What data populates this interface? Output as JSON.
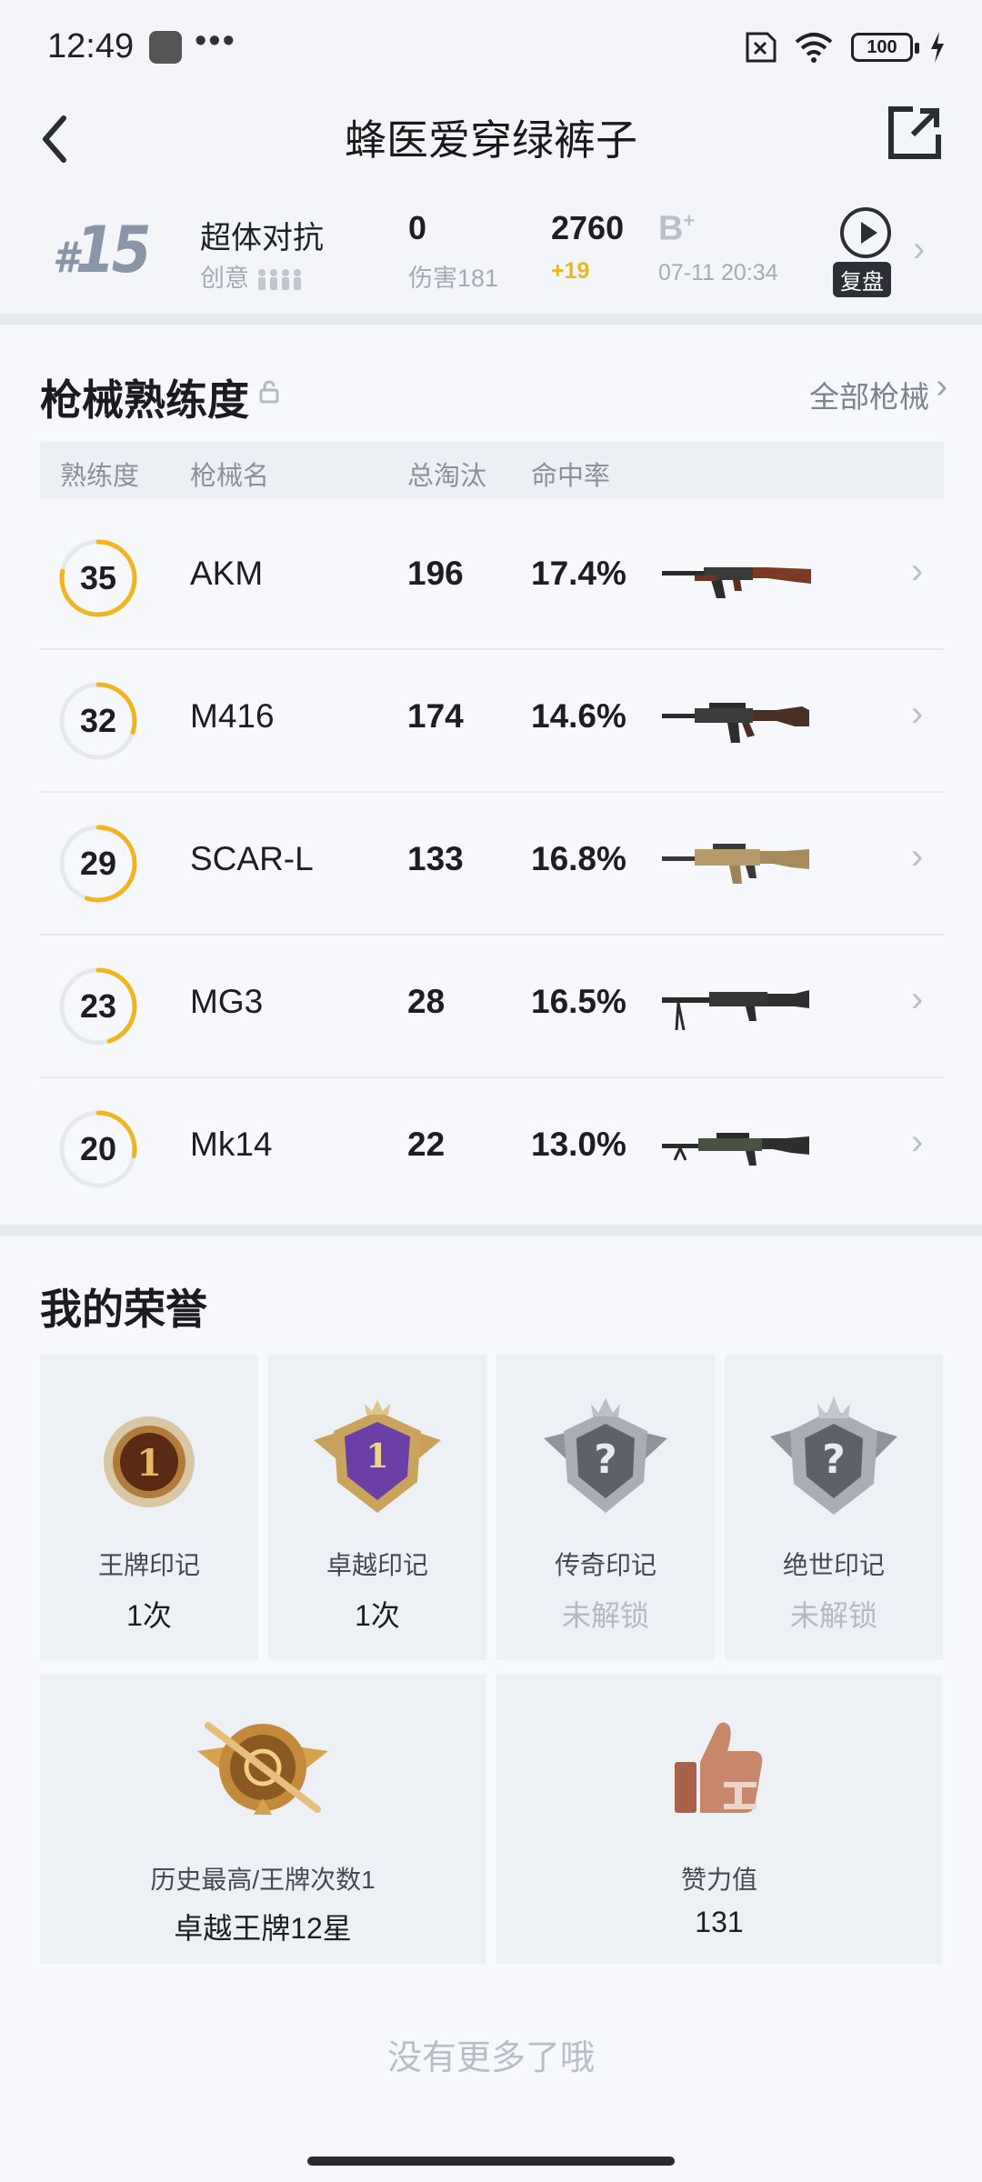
{
  "status_bar": {
    "time": "12:49",
    "dots": "•••",
    "battery": "100"
  },
  "header": {
    "title": "蜂医爱穿绿裤子"
  },
  "match": {
    "rank_hash": "#",
    "rank_num": "15",
    "mode": "超体对抗",
    "mode_sub": "创意",
    "kills": "0",
    "damage": "伤害181",
    "score": "2760",
    "score_delta": "+19",
    "grade": "B",
    "grade_sup": "+",
    "time": "07-11 20:34",
    "replay_label": "复盘"
  },
  "weapons": {
    "title": "枪械熟练度",
    "all_link": "全部枪械",
    "columns": [
      "熟练度",
      "枪械名",
      "总淘汰",
      "命中率"
    ],
    "rows": [
      {
        "level": "35",
        "progress": 0.78,
        "name": "AKM",
        "kills": "196",
        "accuracy": "17.4%"
      },
      {
        "level": "32",
        "progress": 0.3,
        "name": "M416",
        "kills": "174",
        "accuracy": "14.6%"
      },
      {
        "level": "29",
        "progress": 0.55,
        "name": "SCAR-L",
        "kills": "133",
        "accuracy": "16.8%"
      },
      {
        "level": "23",
        "progress": 0.45,
        "name": "MG3",
        "kills": "28",
        "accuracy": "16.5%"
      },
      {
        "level": "20",
        "progress": 0.28,
        "name": "Mk14",
        "kills": "22",
        "accuracy": "13.0%"
      }
    ]
  },
  "honors": {
    "title": "我的荣誉",
    "badges": [
      {
        "label": "王牌印记",
        "value": "1次",
        "locked": false,
        "icon": "ace-medal-icon"
      },
      {
        "label": "卓越印记",
        "value": "1次",
        "locked": false,
        "icon": "excellence-badge-icon"
      },
      {
        "label": "传奇印记",
        "value": "未解锁",
        "locked": true,
        "icon": "legend-badge-icon"
      },
      {
        "label": "绝世印记",
        "value": "未解锁",
        "locked": true,
        "icon": "peerless-badge-icon"
      }
    ],
    "highest": {
      "label": "历史最高/王牌次数1",
      "value": "卓越王牌12星"
    },
    "likes": {
      "label": "赞力值",
      "value": "131"
    }
  },
  "footer": {
    "no_more": "没有更多了哦"
  },
  "colors": {
    "accent_ring": "#f2b51d",
    "ring_track": "#e6e9ee",
    "page_bg": "#f3f5f9"
  }
}
